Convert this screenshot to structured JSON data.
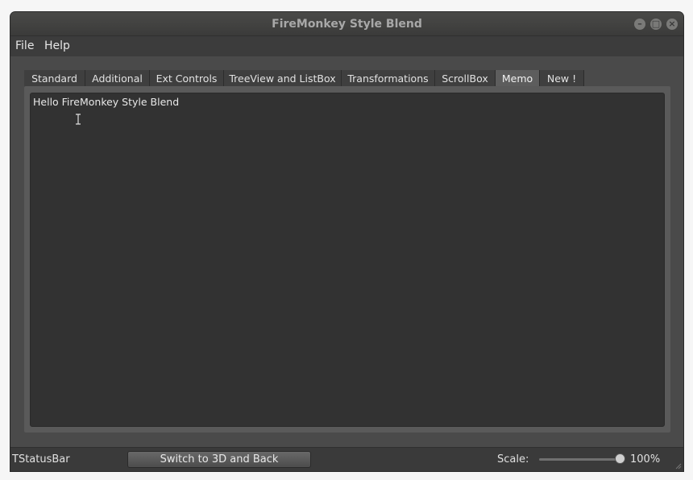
{
  "window": {
    "title": "FireMonkey Style Blend",
    "controls": [
      "minimize-icon",
      "maximize-icon",
      "close-icon"
    ]
  },
  "menubar": {
    "items": [
      {
        "label": "File"
      },
      {
        "label": "Help"
      }
    ]
  },
  "tabs": {
    "items": [
      {
        "label": "Standard"
      },
      {
        "label": "Additional"
      },
      {
        "label": "Ext Controls"
      },
      {
        "label": "TreeView and ListBox"
      },
      {
        "label": "Transformations"
      },
      {
        "label": "ScrollBox"
      },
      {
        "label": "Memo",
        "active": true
      },
      {
        "label": "New !"
      }
    ]
  },
  "memo": {
    "text": "Hello FireMonkey Style Blend"
  },
  "statusbar": {
    "label": "TStatusBar",
    "switch_button": "Switch to 3D and Back",
    "scale_label": "Scale:",
    "scale_value": "100%",
    "scale_fraction": 1.0
  },
  "colors": {
    "window_bg": "#4a4a4a",
    "memo_bg": "#323232",
    "active_tab": "#5d5d5d",
    "text": "#e6e6e6"
  }
}
